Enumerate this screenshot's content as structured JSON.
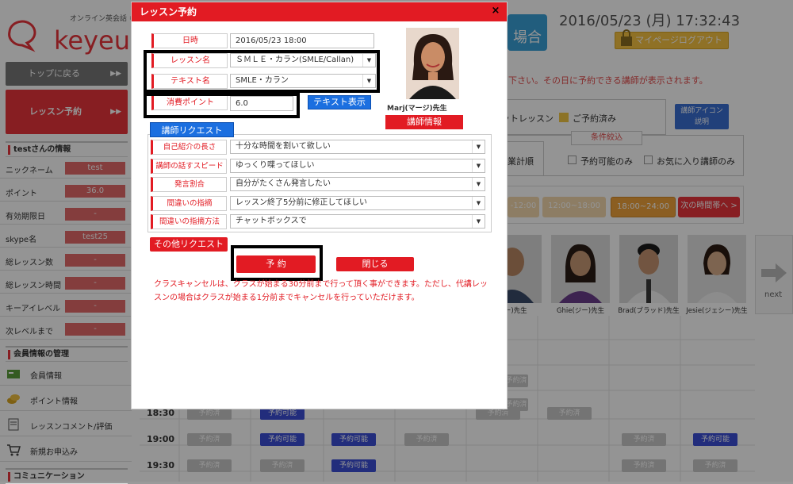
{
  "background": {
    "logo_text": "keyeu",
    "logo_sub": "オンライン英会話 キー",
    "datetime": "2016/05/23 (月) 17:32:43",
    "top_right_button_label": "場合",
    "logout_label": "マイページログアウト",
    "sidebar": {
      "top_label": "トップに戻る",
      "lesson_label": "レッスン予約",
      "user_section": "testさんの情報",
      "user_info": [
        {
          "label": "ニックネーム",
          "value": "test"
        },
        {
          "label": "ポイント",
          "value": "36.0"
        },
        {
          "label": "有効期限日",
          "value": "-"
        },
        {
          "label": "skype名",
          "value": "test25"
        },
        {
          "label": "総レッスン数",
          "value": "-"
        },
        {
          "label": "総レッスン時間",
          "value": "-"
        },
        {
          "label": "キーアイレベル",
          "value": "-"
        },
        {
          "label": "次レベルまで",
          "value": "-"
        }
      ],
      "member_section": "会員情報の管理",
      "menu": [
        {
          "label": "会員情報",
          "icon": "card-icon"
        },
        {
          "label": "ポイント情報",
          "icon": "coins-icon"
        },
        {
          "label": "レッスンコメント/評価",
          "icon": "document-icon"
        },
        {
          "label": "新規お申込み",
          "icon": "cart-icon"
        }
      ],
      "comm_section": "コミュニケーション"
    },
    "notice": "で下さい。その日に予約できる講師が表示されます。",
    "legend": {
      "a": "ットレッスン",
      "b": "ご予約済み"
    },
    "icon_button": "講師アイコン\n説明",
    "sort_label": "業計順",
    "filter": {
      "title": "条件絞込",
      "a": "予約可能のみ",
      "b": "お気に入り講師のみ"
    },
    "time_tabs": [
      "-12:00",
      "12:00~18:00",
      "18:00~24:00",
      "次の時間帯へ >"
    ],
    "teachers": [
      {
        "name": "キー)先生"
      },
      {
        "name": "Ghie(ジー)先生"
      },
      {
        "name": "Brad(ブラッド)先生"
      },
      {
        "name": "Jesie(ジェシー)先生"
      }
    ],
    "next_label": "next",
    "schedule": [
      {
        "time": "18:30",
        "slots": [
          {
            "label": "予約済",
            "kind": "done"
          },
          {
            "label": "予約可能",
            "kind": "open"
          },
          {
            "label": "予約済",
            "kind": "done"
          },
          {
            "label": "予約済",
            "kind": "done"
          }
        ]
      },
      {
        "time": "19:00",
        "slots": [
          {
            "label": "予約済",
            "kind": "done"
          },
          {
            "label": "予約可能",
            "kind": "open"
          },
          {
            "label": "予約可能",
            "kind": "open"
          },
          {
            "label": "予約済",
            "kind": "done"
          },
          {
            "label": "予約済",
            "kind": "done"
          },
          {
            "label": "予約可能",
            "kind": "open"
          }
        ]
      },
      {
        "time": "19:30",
        "slots": [
          {
            "label": "予約済",
            "kind": "done"
          },
          {
            "label": "予約済",
            "kind": "done"
          },
          {
            "label": "予約可能",
            "kind": "open"
          },
          {
            "label": "予約済",
            "kind": "done"
          },
          {
            "label": "予約済",
            "kind": "done"
          }
        ]
      }
    ],
    "extra_done_slots": [
      "予約済",
      "予約済"
    ]
  },
  "modal": {
    "title": "レッスン予約",
    "close_glyph": "×",
    "fields": {
      "date": {
        "label": "日時",
        "value": "2016/05/23 18:00"
      },
      "lesson": {
        "label": "レッスン名",
        "value": "ＳＭＬＥ・カラン(SMLE/Callan)"
      },
      "text": {
        "label": "テキスト名",
        "value": "SMLE・カラン"
      },
      "points": {
        "label": "消費ポイント",
        "value": "6.0"
      }
    },
    "text_button": "テキスト表示",
    "teacher_name": "Marj(マージ)先生",
    "teacher_info_button": "講師情報",
    "request_header": "講師リクエスト",
    "requests": [
      {
        "label": "自己紹介の長さ",
        "value": "十分な時間を割いて欲しい"
      },
      {
        "label": "講師の話すスピード",
        "value": "ゆっくり喋ってほしい"
      },
      {
        "label": "発言割合",
        "value": "自分がたくさん発言したい"
      },
      {
        "label": "間違いの指摘",
        "value": "レッスン終了5分前に修正してほしい"
      },
      {
        "label": "間違いの指摘方法",
        "value": "チャットボックスで"
      }
    ],
    "other_request_button": "その他リクエスト",
    "reserve_button": "予 約",
    "close_button": "閉じる",
    "note": "クラスキャンセルは、クラスが始まる30分前まで行って頂く事ができます。ただし、代講レッスンの場合はクラスが始まる1分前までキャンセルを行っていただけます。",
    "dropdown_glyph": "▼"
  },
  "colors": {
    "accent": "#e21b23",
    "blue": "#1b6fe0",
    "slot_open": "#3b4fd6"
  }
}
